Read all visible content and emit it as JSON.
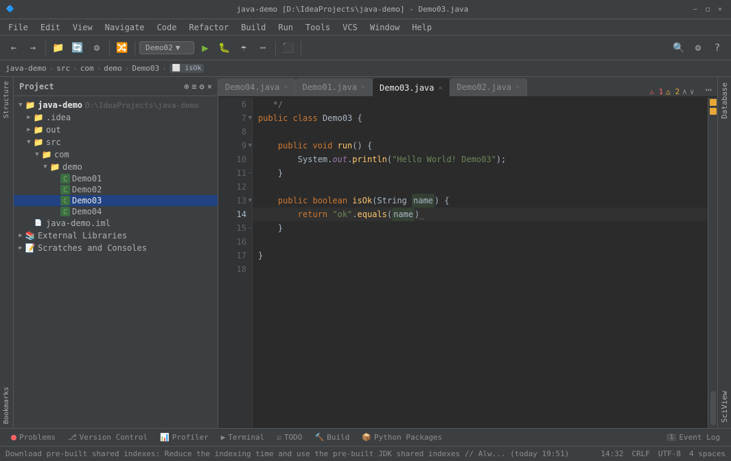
{
  "titleBar": {
    "title": "java-demo [D:\\IdeaProjects\\java-demo] - Demo03.java",
    "minimizeBtn": "–",
    "maximizeBtn": "□",
    "closeBtn": "×"
  },
  "menuBar": {
    "items": [
      "File",
      "Edit",
      "View",
      "Navigate",
      "Code",
      "Refactor",
      "Build",
      "Run",
      "Tools",
      "VCS",
      "Window",
      "Help"
    ]
  },
  "toolbar": {
    "runConfig": "Demo02",
    "searchLabel": "🔍"
  },
  "breadcrumb": {
    "items": [
      "java-demo",
      "src",
      "com",
      "demo",
      "Demo03",
      "isOk"
    ]
  },
  "projectPanel": {
    "title": "Project",
    "root": "java-demo",
    "rootPath": "D:\\IdeaProjects\\java-demo",
    "tree": [
      {
        "indent": 0,
        "type": "root",
        "label": "java-demo",
        "path": "D:\\IdeaProjects\\java-demo",
        "expanded": true
      },
      {
        "indent": 1,
        "type": "folder",
        "label": ".idea",
        "expanded": false
      },
      {
        "indent": 1,
        "type": "folder",
        "label": "out",
        "expanded": false
      },
      {
        "indent": 1,
        "type": "folder",
        "label": "src",
        "expanded": true
      },
      {
        "indent": 2,
        "type": "folder",
        "label": "com",
        "expanded": true
      },
      {
        "indent": 3,
        "type": "folder",
        "label": "demo",
        "expanded": true
      },
      {
        "indent": 4,
        "type": "java",
        "label": "Demo01"
      },
      {
        "indent": 4,
        "type": "java",
        "label": "Demo02"
      },
      {
        "indent": 4,
        "type": "java",
        "label": "Demo03",
        "selected": true
      },
      {
        "indent": 4,
        "type": "java",
        "label": "Demo04"
      },
      {
        "indent": 1,
        "type": "iml",
        "label": "java-demo.iml"
      },
      {
        "indent": 0,
        "type": "extlib",
        "label": "External Libraries",
        "expanded": false
      },
      {
        "indent": 0,
        "type": "scratch",
        "label": "Scratches and Consoles",
        "expanded": false
      }
    ]
  },
  "editor": {
    "tabs": [
      {
        "label": "Demo04.java",
        "active": false
      },
      {
        "label": "Demo01.java",
        "active": false
      },
      {
        "label": "Demo03.java",
        "active": true
      },
      {
        "label": "Demo02.java",
        "active": false
      }
    ],
    "notifications": {
      "errorCount": 1,
      "warnCount": 2
    },
    "lines": [
      {
        "num": 6,
        "content": "   */",
        "type": "comment"
      },
      {
        "num": 7,
        "content": "public class Demo03 {",
        "type": "code"
      },
      {
        "num": 8,
        "content": "",
        "type": "code"
      },
      {
        "num": 9,
        "content": "    public void run() {",
        "type": "code"
      },
      {
        "num": 10,
        "content": "        System.out.println(\"Hello World! Demo03\");",
        "type": "code"
      },
      {
        "num": 11,
        "content": "    }",
        "type": "code"
      },
      {
        "num": 12,
        "content": "",
        "type": "code"
      },
      {
        "num": 13,
        "content": "    public boolean isOk(String name) {",
        "type": "code"
      },
      {
        "num": 14,
        "content": "        return \"ok\".equals(name);",
        "type": "code",
        "hasBulb": true,
        "cursor": true
      },
      {
        "num": 15,
        "content": "    }",
        "type": "code",
        "foldEnd": true
      },
      {
        "num": 16,
        "content": "",
        "type": "code"
      },
      {
        "num": 17,
        "content": "}",
        "type": "code"
      },
      {
        "num": 18,
        "content": "",
        "type": "code"
      }
    ]
  },
  "bottomTabs": {
    "items": [
      {
        "label": "Problems",
        "icon": "⚠",
        "hasError": true
      },
      {
        "label": "Version Control",
        "icon": "⎇"
      },
      {
        "label": "Profiler",
        "icon": "📊"
      },
      {
        "label": "Terminal",
        "icon": "▶"
      },
      {
        "label": "TODO",
        "icon": "☑"
      },
      {
        "label": "Build",
        "icon": "🔨"
      },
      {
        "label": "Python Packages",
        "icon": "📦"
      }
    ],
    "eventLog": {
      "label": "Event Log",
      "count": "1"
    }
  },
  "statusBar": {
    "message": "Download pre-built shared indexes: Reduce the indexing time and use the pre-built JDK shared indexes // Alw... (today 19:51)",
    "position": "14:32",
    "lineEnding": "CRLF",
    "encoding": "UTF-8",
    "indent": "4 spaces"
  },
  "rightSidebar": {
    "tabs": [
      "Database",
      "SciView"
    ]
  }
}
